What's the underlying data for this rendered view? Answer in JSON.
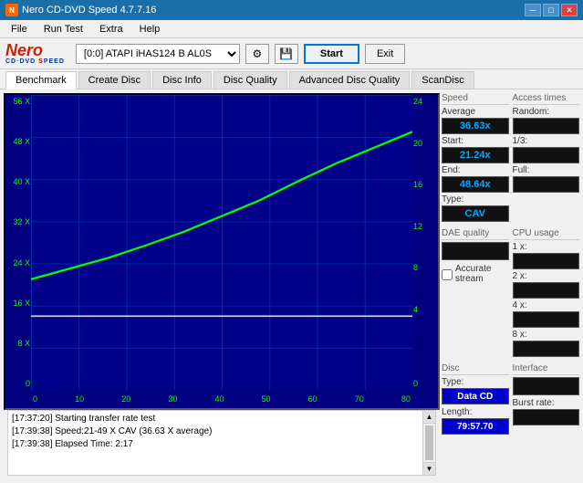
{
  "titlebar": {
    "title": "Nero CD-DVD Speed 4.7.7.16",
    "icon": "N",
    "buttons": [
      "minimize",
      "maximize",
      "close"
    ]
  },
  "menubar": {
    "items": [
      "File",
      "Run Test",
      "Extra",
      "Help"
    ]
  },
  "toolbar": {
    "drive_selector": "[0:0]  ATAPI iHAS124  B AL0S",
    "start_label": "Start",
    "exit_label": "Exit"
  },
  "tabs": {
    "items": [
      "Benchmark",
      "Create Disc",
      "Disc Info",
      "Disc Quality",
      "Advanced Disc Quality",
      "ScanDisc"
    ],
    "active": "Benchmark"
  },
  "chart": {
    "y_left_labels": [
      "56 X",
      "48 X",
      "40 X",
      "32 X",
      "24 X",
      "16 X",
      "8 X",
      "0"
    ],
    "y_right_labels": [
      "24",
      "20",
      "16",
      "12",
      "8",
      "4",
      "0"
    ],
    "x_labels": [
      "0",
      "10",
      "20",
      "30",
      "40",
      "50",
      "60",
      "70",
      "80"
    ]
  },
  "right_panel": {
    "speed": {
      "section_title": "Speed",
      "average_label": "Average",
      "average_value": "36.63x",
      "start_label": "Start:",
      "start_value": "21.24x",
      "end_label": "End:",
      "end_value": "48.64x",
      "type_label": "Type:",
      "type_value": "CAV"
    },
    "access_times": {
      "section_title": "Access times",
      "random_label": "Random:",
      "random_value": "",
      "one_third_label": "1/3:",
      "one_third_value": "",
      "full_label": "Full:",
      "full_value": ""
    },
    "dae_quality": {
      "section_title": "DAE quality",
      "value": ""
    },
    "cpu_usage": {
      "section_title": "CPU usage",
      "1x_label": "1 x:",
      "1x_value": "",
      "2x_label": "2 x:",
      "2x_value": "",
      "4x_label": "4 x:",
      "4x_value": "",
      "8x_label": "8 x:",
      "8x_value": ""
    },
    "accurate_stream": {
      "label": "Accurate stream"
    },
    "disc": {
      "type_label": "Disc",
      "type_sub": "Type:",
      "type_value": "Data CD",
      "interface_label": "Interface",
      "length_label": "Length:",
      "length_value": "79:57.70",
      "burst_label": "Burst rate:"
    }
  },
  "log": {
    "entries": [
      "[17:37:20]  Starting transfer rate test",
      "[17:39:38]  Speed:21-49 X CAV (36.63 X average)",
      "[17:39:38]  Elapsed Time: 2:17"
    ]
  }
}
